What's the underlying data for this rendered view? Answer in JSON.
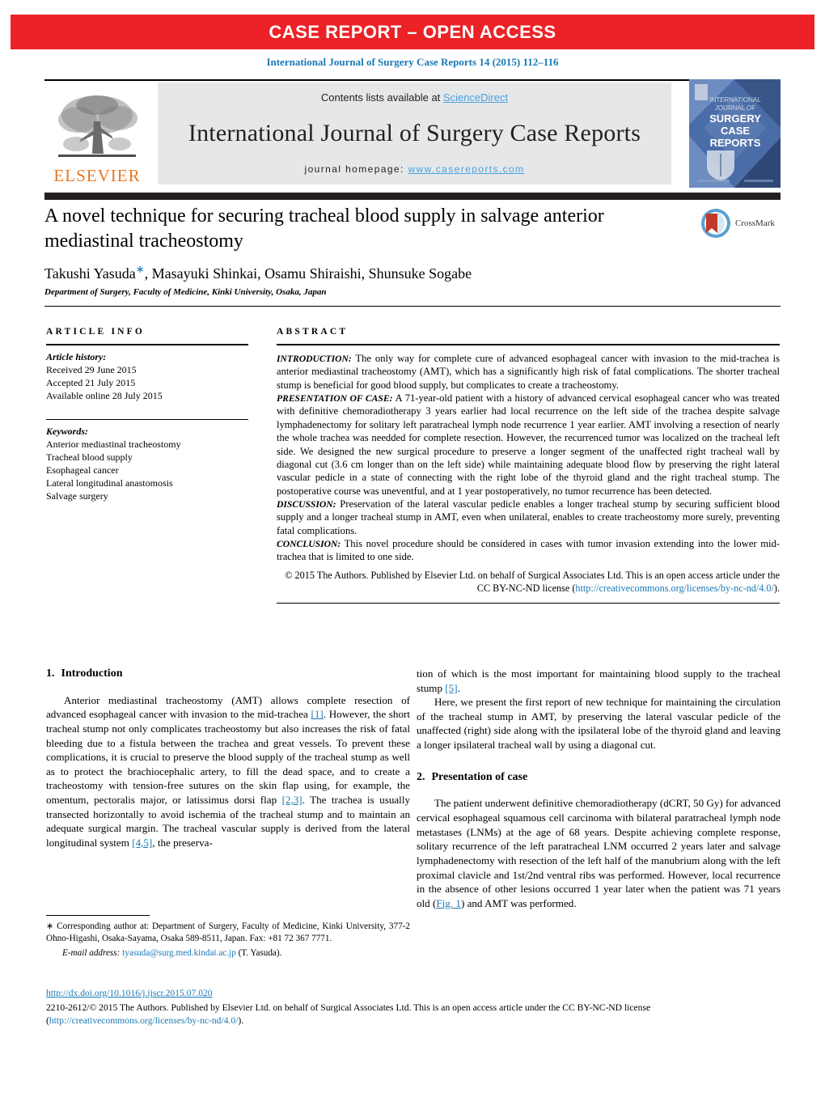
{
  "banner": {
    "text": "CASE REPORT – OPEN ACCESS",
    "bg_color": "#ec2227",
    "text_color": "#ffffff"
  },
  "citation_line": "International Journal of Surgery Case Reports 14 (2015) 112–116",
  "journal_header": {
    "contents_prefix": "Contents lists available at ",
    "sciencedirect": "ScienceDirect",
    "journal_title": "International Journal of Surgery Case Reports",
    "homepage_prefix": "journal homepage: ",
    "homepage_url": "www.casereports.com",
    "publisher_logo_text": "ELSEVIER",
    "cover_lines": [
      "INTERNATIONAL",
      "JOURNAL OF",
      "SURGERY",
      "CASE",
      "REPORTS"
    ],
    "link_color": "#4aa3df",
    "strip_bg": "#e6e7e8"
  },
  "article": {
    "title": "A novel technique for securing tracheal blood supply in salvage anterior mediastinal tracheostomy",
    "authors": "Takushi Yasuda",
    "authors_rest": ", Masayuki Shinkai, Osamu Shiraishi, Shunsuke Sogabe",
    "corresponding_marker": "∗",
    "affiliation": "Department of Surgery, Faculty of Medicine, Kinki University, Osaka, Japan",
    "crossmark_label": "CrossMark"
  },
  "article_info": {
    "heading": "ARTICLE INFO",
    "history_label": "Article history:",
    "history": [
      "Received 29 June 2015",
      "Accepted 21 July 2015",
      "Available online 28 July 2015"
    ],
    "keywords_label": "Keywords:",
    "keywords": [
      "Anterior mediastinal tracheostomy",
      "Tracheal blood supply",
      "Esophageal cancer",
      "Lateral longitudinal anastomosis",
      "Salvage surgery"
    ]
  },
  "abstract": {
    "heading": "ABSTRACT",
    "sections": [
      {
        "lead": "INTRODUCTION:",
        "text": " The only way for complete cure of advanced esophageal cancer with invasion to the mid-trachea is anterior mediastinal tracheostomy (AMT), which has a significantly high risk of fatal complications. The shorter tracheal stump is beneficial for good blood supply, but complicates to create a tracheostomy."
      },
      {
        "lead": "PRESENTATION OF CASE:",
        "text": " A 71-year-old patient with a history of advanced cervical esophageal cancer who was treated with definitive chemoradiotherapy 3 years earlier had local recurrence on the left side of the trachea despite salvage lymphadenectomy for solitary left paratracheal lymph node recurrence 1 year earlier. AMT involving a resection of nearly the whole trachea was needded for complete resection. However, the recurrenced tumor was localized on the tracheal left side. We designed the new surgical procedure to preserve a longer segment of the unaffected right tracheal wall by diagonal cut (3.6 cm longer than on the left side) while maintaining adequate blood flow by preserving the right lateral vascular pedicle in a state of connecting with the right lobe of the thyroid gland and the right tracheal stump. The postoperative course was uneventful, and at 1 year postoperatively, no tumor recurrence has been detected."
      },
      {
        "lead": "DISCUSSION:",
        "text": " Preservation of the lateral vascular pedicle enables a longer tracheal stump by securing sufficient blood supply and a longer tracheal stump in AMT, even when unilateral, enables to create tracheostomy more surely, preventing fatal complications."
      },
      {
        "lead": "CONCLUSION:",
        "text": " This novel procedure should be considered in cases with tumor invasion extending into the lower mid-trachea that is limited to one side."
      }
    ],
    "copyright_text": "© 2015 The Authors. Published by Elsevier Ltd. on behalf of Surgical Associates Ltd. This is an open access article under the CC BY-NC-ND license (",
    "copyright_link": "http://creativecommons.org/licenses/by-nc-nd/4.0/",
    "copyright_tail": ")."
  },
  "body": {
    "left_heading_num": "1.",
    "left_heading": "Introduction",
    "left_p1_a": "Anterior mediastinal tracheostomy (AMT) allows complete resection of advanced esophageal cancer with invasion to the mid-trachea ",
    "left_ref1": "[1]",
    "left_p1_b": ". However, the short tracheal stump not only complicates tracheostomy but also increases the risk of fatal bleeding due to a fistula between the trachea and great vessels. To prevent these complications, it is crucial to preserve the blood supply of the tracheal stump as well as to protect the brachiocephalic artery, to fill the dead space, and to create a tracheostomy with tension-free sutures on the skin flap using, for example, the omentum, pectoralis major, or latissimus dorsi flap ",
    "left_ref2": "[2,3]",
    "left_p1_c": ". The trachea is usually transected horizontally to avoid ischemia of the tracheal stump and to maintain an adequate surgical margin. The tracheal vascular supply is derived from the lateral longitudinal system ",
    "left_ref3": "[4,5]",
    "left_p1_d": ", the preserva-",
    "right_p1_a": "tion of which is the most important for maintaining blood supply to the tracheal stump ",
    "right_ref1": "[5]",
    "right_p1_b": ".",
    "right_p2": "Here, we present the first report of new technique for maintaining the circulation of the tracheal stump in AMT, by preserving the lateral vascular pedicle of the unaffected (right) side along with the ipsilateral lobe of the thyroid gland and leaving a longer ipsilateral tracheal wall by using a diagonal cut.",
    "right_heading_num": "2.",
    "right_heading": "Presentation of case",
    "right_p3_a": "The patient underwent definitive chemoradiotherapy (dCRT, 50 Gy) for advanced cervical esophageal squamous cell carcinoma with bilateral paratracheal lymph node metastases (LNMs) at the age of 68 years. Despite achieving complete response, solitary recurrence of the left paratracheal LNM occurred 2 years later and salvage lymphadenectomy with resection of the left half of the manubrium along with the left proximal clavicle and 1st/2nd ventral ribs was performed. However, local recurrence in the absence of other lesions occurred 1 year later when the patient was 71 years old (",
    "right_figref": "Fig. 1",
    "right_p3_b": ") and AMT was performed."
  },
  "footnote": {
    "star": "∗",
    "text": " Corresponding author at: Department of Surgery, Faculty of Medicine, Kinki University, 377-2 Ohno-Higashi, Osaka-Sayama, Osaka 589-8511, Japan. Fax: +81 72 367 7771.",
    "email_label": "E-mail address:",
    "email": "tyasuda@surg.med.kindai.ac.jp",
    "email_attrib": " (T. Yasuda)."
  },
  "bottom": {
    "doi": "http://dx.doi.org/10.1016/j.ijscr.2015.07.020",
    "issn_text": "2210-2612/© 2015 The Authors. Published by Elsevier Ltd. on behalf of Surgical Associates Ltd. This is an open access article under the CC BY-NC-ND license (",
    "license_link": "http://creativecommons.org/licenses/by-nc-nd/4.0/",
    "tail": ")."
  },
  "colors": {
    "accent_red": "#ec2227",
    "link_blue": "#1a79b5",
    "elsevier_orange": "#e87722"
  }
}
